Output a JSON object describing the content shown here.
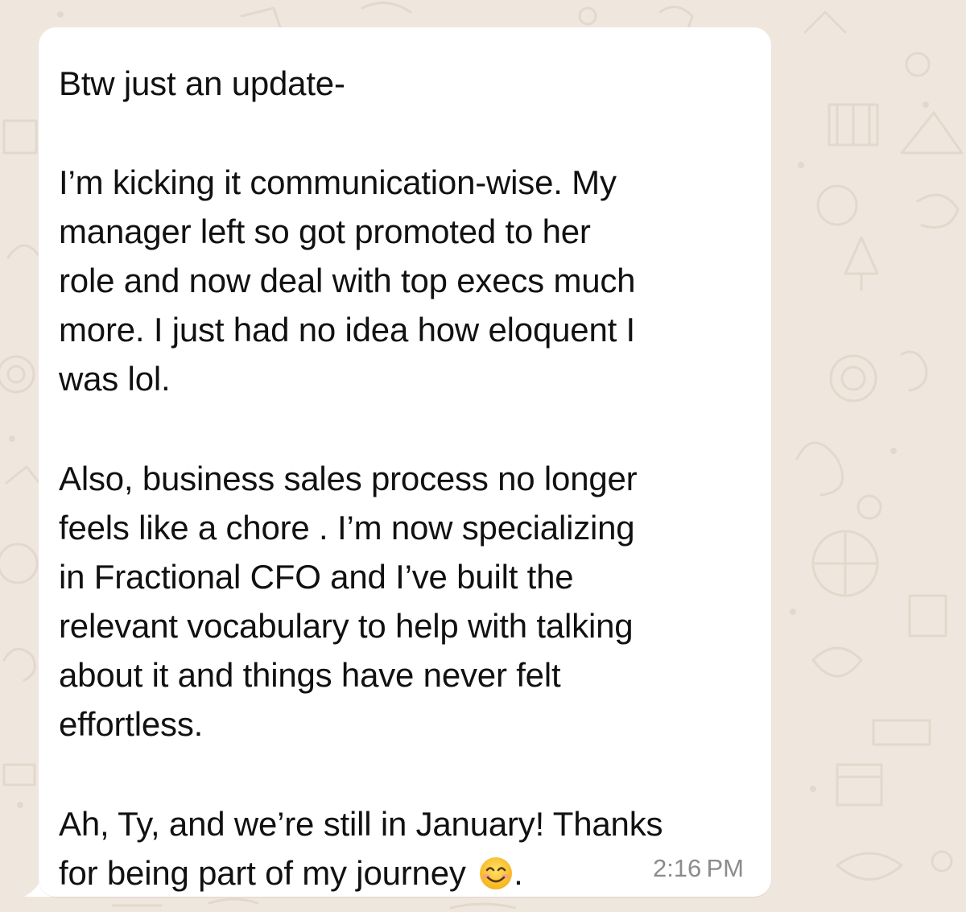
{
  "message": {
    "lines": [
      "Btw just an update-",
      "I’m kicking it communication-wise. My",
      "manager left so got promoted to her",
      "role and now deal with top execs much",
      "more. I just had no idea how eloquent I",
      "was lol.",
      "Also, business sales process no longer",
      "feels like a chore . I’m now specializing",
      "in Fractional CFO and I’ve built the",
      "relevant vocabulary to help with talking",
      "about it and things have never felt",
      "effortless.",
      "Ah, Ty, and we’re still in January! Thanks",
      "for being part of my journey"
    ],
    "last_line_suffix": ".",
    "emoji": "smiling-face-emoji",
    "time": "2:16 PM"
  },
  "colors": {
    "chat_background": "#efe7dd",
    "bubble": "#ffffff",
    "text": "#111111",
    "timestamp": "#8c8c8c"
  }
}
